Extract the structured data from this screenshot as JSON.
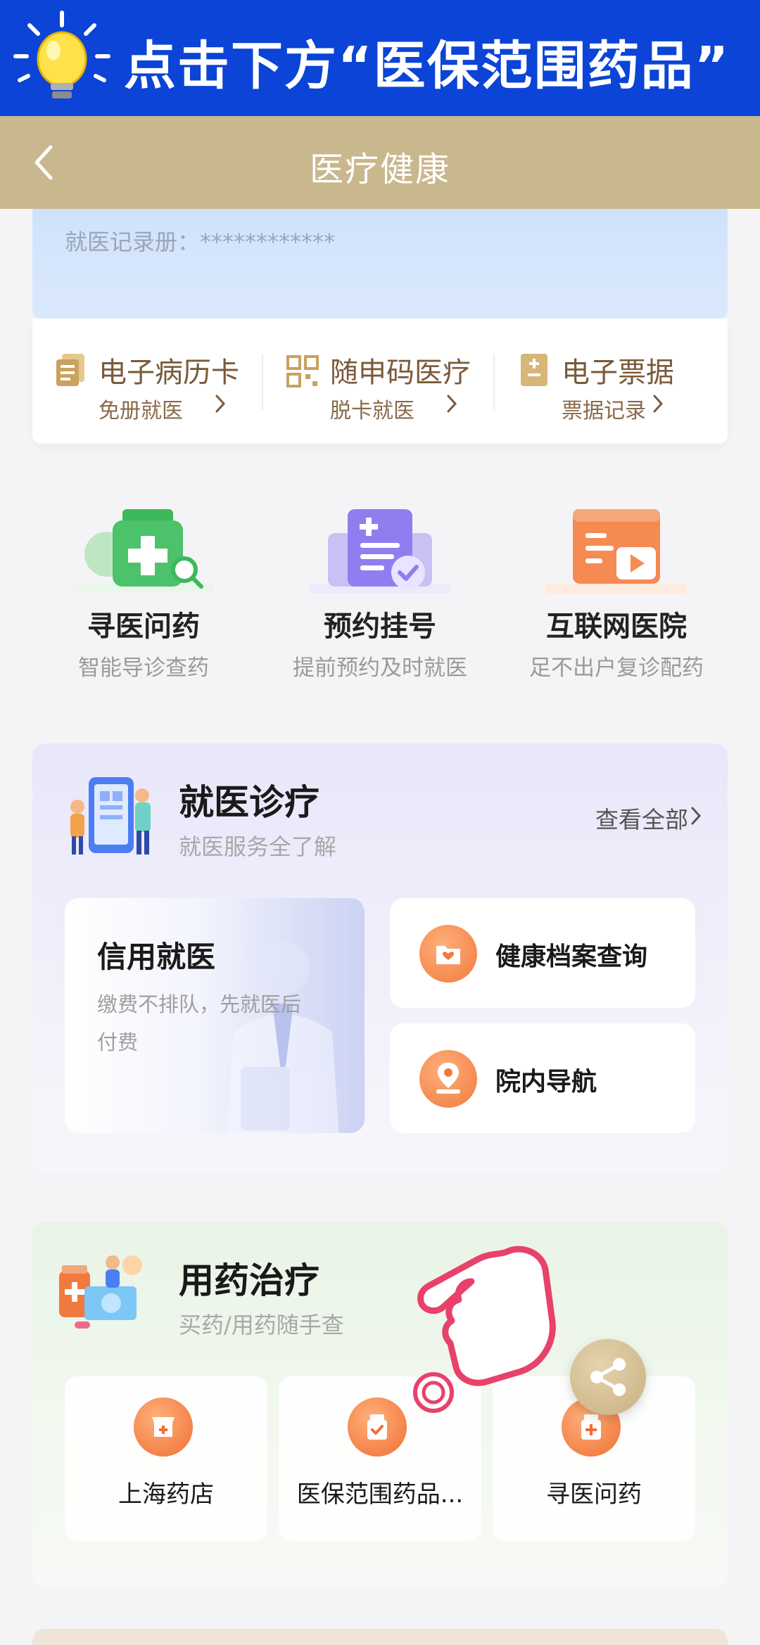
{
  "banner": {
    "text": "点击下方“医保范围药品”",
    "bg_color": "#0b44d6",
    "icon": "lightbulb-icon"
  },
  "navbar": {
    "title": "医疗健康",
    "back_icon": "chevron-left-icon",
    "bg_color": "#c9b78d"
  },
  "record": {
    "label": "就医记录册：************"
  },
  "shortcuts": [
    {
      "title": "电子病历卡",
      "sub": "免册就医",
      "icon": "medical-record-icon"
    },
    {
      "title": "随申码医疗",
      "sub": "脱卡就医",
      "icon": "qr-code-icon"
    },
    {
      "title": "电子票据",
      "sub": "票据记录",
      "icon": "receipt-icon"
    }
  ],
  "services": [
    {
      "title": "寻医问药",
      "sub": "智能导诊查药",
      "icon": "medicine-search-icon"
    },
    {
      "title": "预约挂号",
      "sub": "提前预约及时就医",
      "icon": "appointment-icon"
    },
    {
      "title": "互联网医院",
      "sub": "足不出户复诊配药",
      "icon": "internet-hospital-icon"
    }
  ],
  "clinic": {
    "title": "就医诊疗",
    "sub": "就医服务全了解",
    "see_all": "查看全部",
    "credit": {
      "title": "信用就医",
      "sub": "缴费不排队，先就医后付费"
    },
    "items": [
      {
        "label": "健康档案查询",
        "icon": "health-folder-icon"
      },
      {
        "label": "院内导航",
        "icon": "location-pin-icon"
      }
    ]
  },
  "medication": {
    "title": "用药治疗",
    "sub": "买药/用药随手查",
    "items": [
      {
        "label": "上海药店",
        "icon": "pharmacy-icon"
      },
      {
        "label": "医保范围药品...",
        "icon": "insured-medicine-icon"
      },
      {
        "label": "寻医问药",
        "icon": "medicine-consult-icon"
      }
    ]
  },
  "floating": {
    "share_icon": "share-icon",
    "pointer_icon": "tap-hand-icon"
  }
}
